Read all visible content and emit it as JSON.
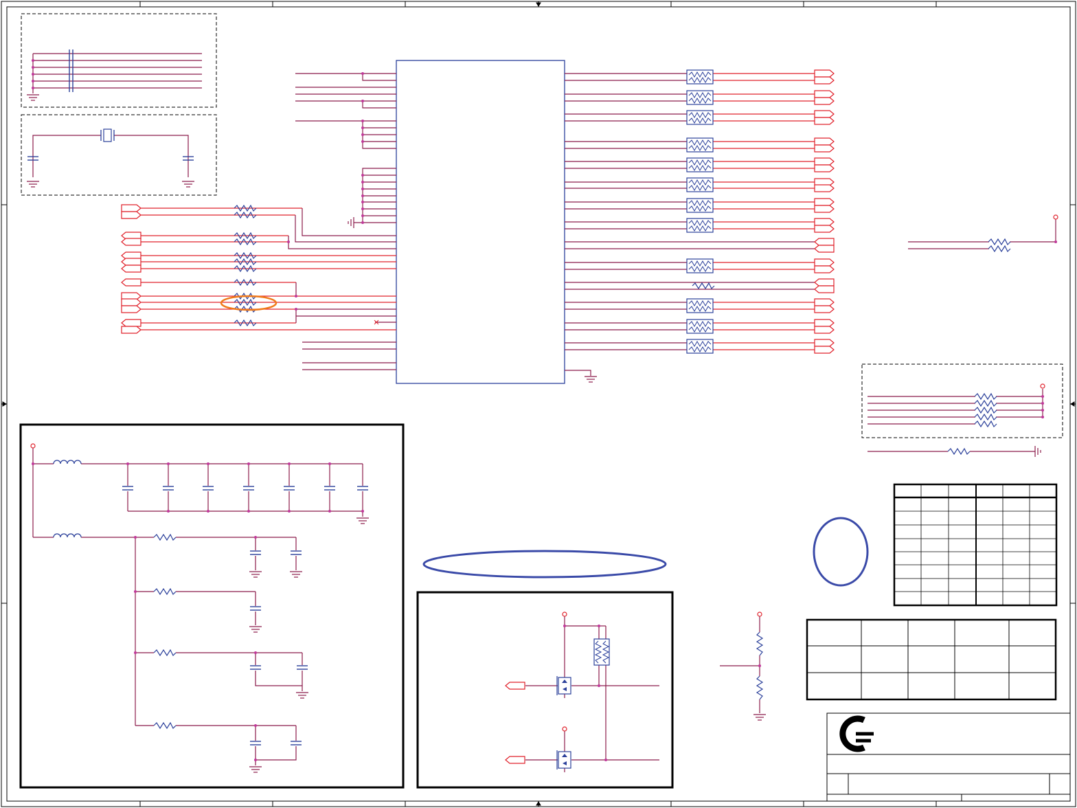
{
  "colors": {
    "wire": "#8b1a4a",
    "net": "#e0202a",
    "part": "#2a3f9a",
    "frame": "#000000",
    "junction": "#c0389a",
    "highlight_orange": "#f07a1a",
    "highlight_blue": "#3a4aa8",
    "logo": "#000000"
  },
  "diagram": {
    "type": "schematic",
    "grid_table_rows": 9,
    "grid_table_cols": 6,
    "title_table_rows": 3,
    "title_table_cols": 5,
    "logo": "company-logo-mark"
  }
}
